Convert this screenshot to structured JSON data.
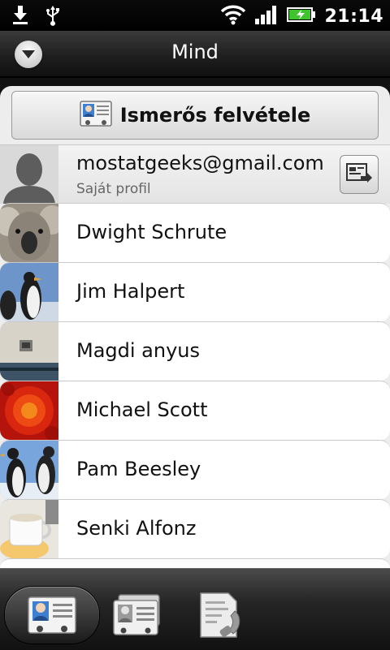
{
  "status_bar": {
    "time": "21:14",
    "icons": [
      "download-icon",
      "usb-icon",
      "wifi-icon",
      "signal-icon",
      "battery-charging-icon"
    ]
  },
  "header": {
    "title": "Mind",
    "dropdown_icon": "chevron-down-icon"
  },
  "add_contact": {
    "label": "Ismerős felvétele",
    "icon": "contact-card-icon"
  },
  "profile": {
    "email": "mostatgeeks@gmail.com",
    "subtitle": "Saját profil",
    "action_icon": "send-card-icon"
  },
  "contacts": [
    {
      "name": "Dwight Schrute",
      "photo": "koala"
    },
    {
      "name": "Jim Halpert",
      "photo": "penguins"
    },
    {
      "name": "Magdi anyus",
      "photo": "lighthouse"
    },
    {
      "name": "Michael Scott",
      "photo": "chrysanthemum"
    },
    {
      "name": "Pam Beesley",
      "photo": "penguins"
    },
    {
      "name": "Senki Alfonz",
      "photo": "coffee-cup"
    }
  ],
  "tabs": [
    {
      "name": "contacts-tab",
      "icon": "contact-card-icon",
      "active": true
    },
    {
      "name": "groups-tab",
      "icon": "contact-cards-stack-icon",
      "active": false
    },
    {
      "name": "call-history-tab",
      "icon": "phone-document-icon",
      "active": false
    }
  ],
  "colors": {
    "title_bar": "#1f1f1f",
    "list_background": "#ffffff",
    "battery_green": "#3fc42f"
  }
}
